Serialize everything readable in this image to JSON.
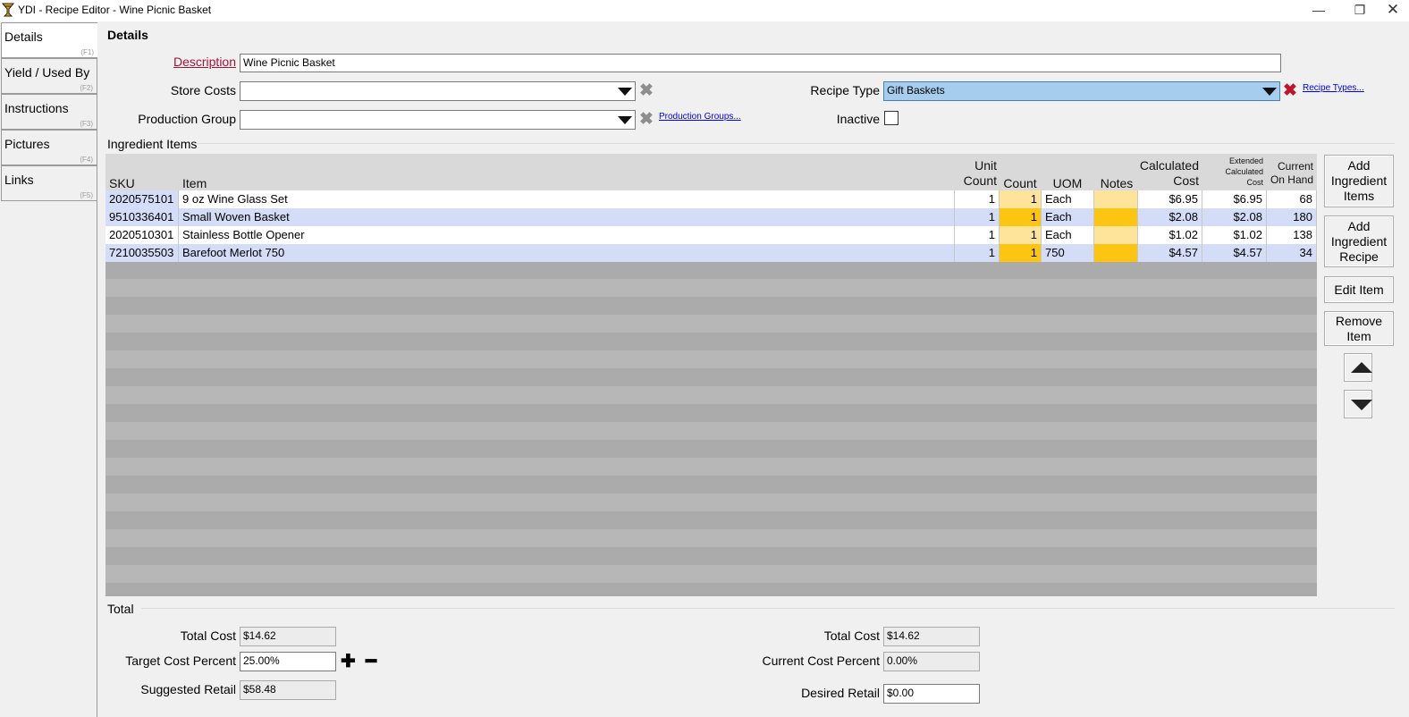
{
  "window": {
    "title": "YDI - Recipe Editor - Wine Picnic Basket",
    "minimize_glyph": "—",
    "maximize_glyph": "❐",
    "close_glyph": "✕"
  },
  "tabs": [
    {
      "label": "Details",
      "key": "(F1)"
    },
    {
      "label": "Yield / Used By",
      "key": "(F2)"
    },
    {
      "label": "Instructions",
      "key": "(F3)"
    },
    {
      "label": "Pictures",
      "key": "(F4)"
    },
    {
      "label": "Links",
      "key": "(F5)"
    }
  ],
  "details": {
    "heading": "Details",
    "description_label": "Description",
    "description_value": "Wine Picnic Basket",
    "store_costs_label": "Store Costs",
    "store_costs_value": "",
    "production_group_label": "Production Group",
    "production_group_value": "",
    "production_groups_link": "Production Groups...",
    "recipe_type_label": "Recipe Type",
    "recipe_type_value": "Gift Baskets",
    "recipe_types_link": "Recipe Types...",
    "inactive_label": "Inactive",
    "inactive_checked": false
  },
  "ingredients": {
    "section_title": "Ingredient Items",
    "headers": {
      "sku": "SKU",
      "item": "Item",
      "unit_count_1": "Unit",
      "unit_count_2": "Count",
      "count": "Count",
      "uom": "UOM",
      "notes": "Notes",
      "calc_cost_1": "Calculated",
      "calc_cost_2": "Cost",
      "ext_cost_1": "Extended",
      "ext_cost_2": "Calculated",
      "ext_cost_3": "Cost",
      "on_hand_1": "Current",
      "on_hand_2": "On Hand"
    },
    "rows": [
      {
        "sku": "2020575101",
        "item": "9 oz Wine Glass Set",
        "unit_count": "1",
        "count": "1",
        "uom": "Each",
        "notes": "",
        "calc_cost": "$6.95",
        "ext_cost": "$6.95",
        "on_hand": "68"
      },
      {
        "sku": "9510336401",
        "item": "Small Woven Basket",
        "unit_count": "1",
        "count": "1",
        "uom": "Each",
        "notes": "",
        "calc_cost": "$2.08",
        "ext_cost": "$2.08",
        "on_hand": "180"
      },
      {
        "sku": "2020510301",
        "item": "Stainless Bottle Opener",
        "unit_count": "1",
        "count": "1",
        "uom": "Each",
        "notes": "",
        "calc_cost": "$1.02",
        "ext_cost": "$1.02",
        "on_hand": "138"
      },
      {
        "sku": "7210035503",
        "item": "Barefoot  Merlot 750",
        "unit_count": "1",
        "count": "1",
        "uom": "750",
        "notes": "",
        "calc_cost": "$4.57",
        "ext_cost": "$4.57",
        "on_hand": "34"
      }
    ]
  },
  "side_buttons": {
    "add_items": [
      "Add",
      "Ingredient",
      "Items"
    ],
    "add_recipe": [
      "Add",
      "Ingredient",
      "Recipe"
    ],
    "edit_item": "Edit Item",
    "remove_item": [
      "Remove",
      "Item"
    ],
    "move_up_icon": "triangle-up",
    "move_down_icon": "triangle-down"
  },
  "totals": {
    "section_title": "Total",
    "total_cost_label": "Total Cost",
    "total_cost_value": "$14.62",
    "target_cost_percent_label": "Target Cost Percent",
    "target_cost_percent_value": "25.00%",
    "suggested_retail_label": "Suggested Retail",
    "suggested_retail_value": "$58.48",
    "plus_glyph": "✚",
    "minus_glyph": "━",
    "total_cost_right_label": "Total Cost",
    "total_cost_right_value": "$14.62",
    "current_cost_percent_label": "Current Cost Percent",
    "current_cost_percent_value": "0.00%",
    "desired_retail_label": "Desired Retail",
    "desired_retail_value": "$0.00"
  },
  "colors": {
    "window_bg": "#f0f0f0",
    "row_highlight": "#d4ddf7",
    "count_yellow_light": "#fde49a",
    "count_yellow": "#fcc511",
    "recipe_type_bg": "#a7cdee",
    "description_label": "#a0153e",
    "grid_gray": "#ababab"
  }
}
